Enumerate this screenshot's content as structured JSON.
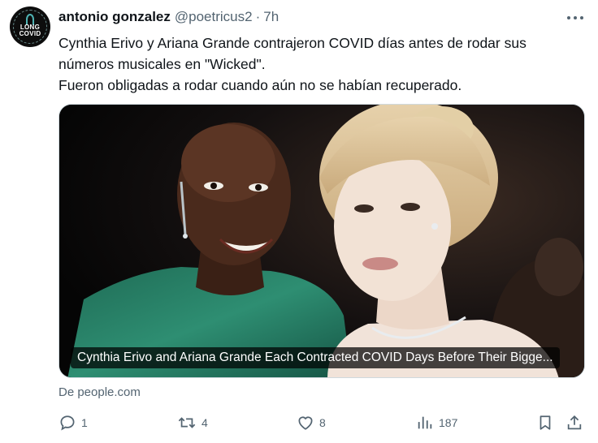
{
  "author": {
    "name": "antonio gonzalez",
    "handle": "@poetricus2",
    "separator": "·",
    "time": "7h",
    "avatar_logo_line1": "LONG",
    "avatar_logo_line2": "COVID"
  },
  "tweet": {
    "lines": [
      "Cynthia Erivo y Ariana Grande contrajeron COVID días antes de rodar sus",
      "números musicales en \"Wicked\".",
      "Fueron obligadas a rodar cuando aún no se habían recuperado."
    ]
  },
  "card": {
    "headline": "Cynthia Erivo and Ariana Grande Each Contracted COVID Days Before Their Bigge...",
    "source": "De people.com",
    "image_icon": "photo-of-two-women"
  },
  "actions": {
    "reply": {
      "icon": "reply-icon",
      "count": "1"
    },
    "retweet": {
      "icon": "retweet-icon",
      "count": "4"
    },
    "like": {
      "icon": "heart-icon",
      "count": "8"
    },
    "views": {
      "icon": "views-icon",
      "count": "187"
    },
    "bookmark": {
      "icon": "bookmark-icon"
    },
    "share": {
      "icon": "share-icon"
    }
  },
  "colors": {
    "text": "#0f1419",
    "secondary": "#536471",
    "border": "#cfd9de",
    "background": "#ffffff"
  }
}
